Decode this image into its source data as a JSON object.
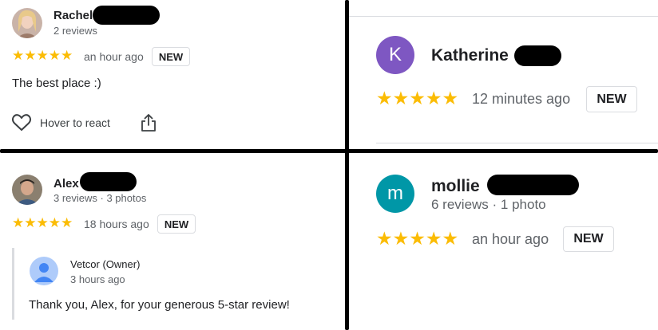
{
  "reviews": {
    "rachel": {
      "name": "Rachel",
      "meta": "2 reviews",
      "stars": "★★★★★",
      "time": "an hour ago",
      "badge": "NEW",
      "text": "The best place :)",
      "react_label": "Hover to react"
    },
    "katherine": {
      "initial": "K",
      "name": "Katherine",
      "stars": "★★★★★",
      "time": "12 minutes ago",
      "badge": "NEW",
      "avatar_color": "#7e57c2"
    },
    "alex": {
      "name": "Alex",
      "meta": "3 reviews · 3 photos",
      "stars": "★★★★★",
      "time": "18 hours ago",
      "badge": "NEW",
      "owner_reply": {
        "name": "Vetcor (Owner)",
        "time": "3 hours ago",
        "text": "Thank you, Alex, for your generous 5-star review!"
      }
    },
    "mollie": {
      "initial": "m",
      "name": "mollie",
      "meta": "6 reviews · 1 photo",
      "stars": "★★★★★",
      "time": "an hour ago",
      "badge": "NEW",
      "avatar_color": "#0097a7"
    }
  },
  "colors": {
    "star": "#fbbc04",
    "owner_avatar": "#4285f4"
  }
}
